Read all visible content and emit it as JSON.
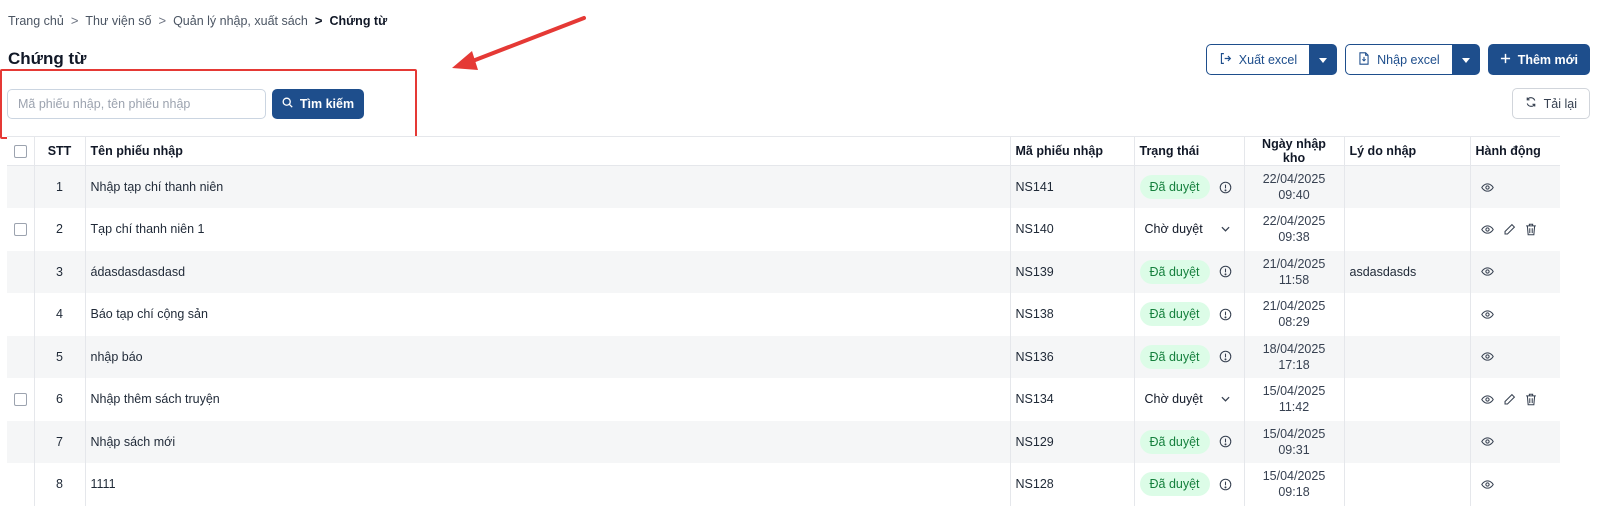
{
  "breadcrumb": {
    "items": [
      "Trang chủ",
      "Thư viện số",
      "Quản lý nhập, xuất sách"
    ],
    "current": "Chứng từ"
  },
  "page": {
    "title": "Chứng từ"
  },
  "toolbar": {
    "export_label": "Xuất excel",
    "import_label": "Nhập excel",
    "add_label": "Thêm mới",
    "reload_label": "Tải lại"
  },
  "search": {
    "placeholder": "Mã phiếu nhập, tên phiếu nhập",
    "value": "",
    "button_label": "Tìm kiếm"
  },
  "table": {
    "columns": {
      "stt": "STT",
      "name": "Tên phiếu nhập",
      "code": "Mã phiếu nhập",
      "status": "Trạng thái",
      "date": "Ngày nhập kho",
      "reason": "Lý do nhập",
      "actions": "Hành động"
    },
    "rows": [
      {
        "stt": "1",
        "name": "Nhập tạp chí thanh niên",
        "code": "NS141",
        "status": "Đã duyệt",
        "date": "22/04/2025",
        "time": "09:40",
        "reason": ""
      },
      {
        "stt": "2",
        "name": "Tạp chí thanh niên 1",
        "code": "NS140",
        "status": "Chờ duyệt",
        "date": "22/04/2025",
        "time": "09:38",
        "reason": ""
      },
      {
        "stt": "3",
        "name": "ádasdasdasdasd",
        "code": "NS139",
        "status": "Đã duyệt",
        "date": "21/04/2025",
        "time": "11:58",
        "reason": "asdasdasds"
      },
      {
        "stt": "4",
        "name": "Báo tạp chí cộng sản",
        "code": "NS138",
        "status": "Đã duyệt",
        "date": "21/04/2025",
        "time": "08:29",
        "reason": ""
      },
      {
        "stt": "5",
        "name": "nhập báo",
        "code": "NS136",
        "status": "Đã duyệt",
        "date": "18/04/2025",
        "time": "17:18",
        "reason": ""
      },
      {
        "stt": "6",
        "name": "Nhập thêm sách truyện",
        "code": "NS134",
        "status": "Chờ duyệt",
        "date": "15/04/2025",
        "time": "11:42",
        "reason": ""
      },
      {
        "stt": "7",
        "name": "Nhập sách mới",
        "code": "NS129",
        "status": "Đã duyệt",
        "date": "15/04/2025",
        "time": "09:31",
        "reason": ""
      },
      {
        "stt": "8",
        "name": "1111",
        "code": "NS128",
        "status": "Đã duyệt",
        "date": "15/04/2025",
        "time": "09:18",
        "reason": ""
      }
    ]
  },
  "colors": {
    "primary": "#1e4e8c",
    "approved_bg": "#dcfce7",
    "approved_text": "#15803d",
    "annotation_red": "#e53935"
  },
  "icons": [
    "export-icon",
    "import-file-icon",
    "plus-icon",
    "caret-down-icon",
    "reload-icon",
    "search-icon",
    "info-icon",
    "chevron-down-icon",
    "eye-icon",
    "pencil-icon",
    "trash-icon"
  ]
}
